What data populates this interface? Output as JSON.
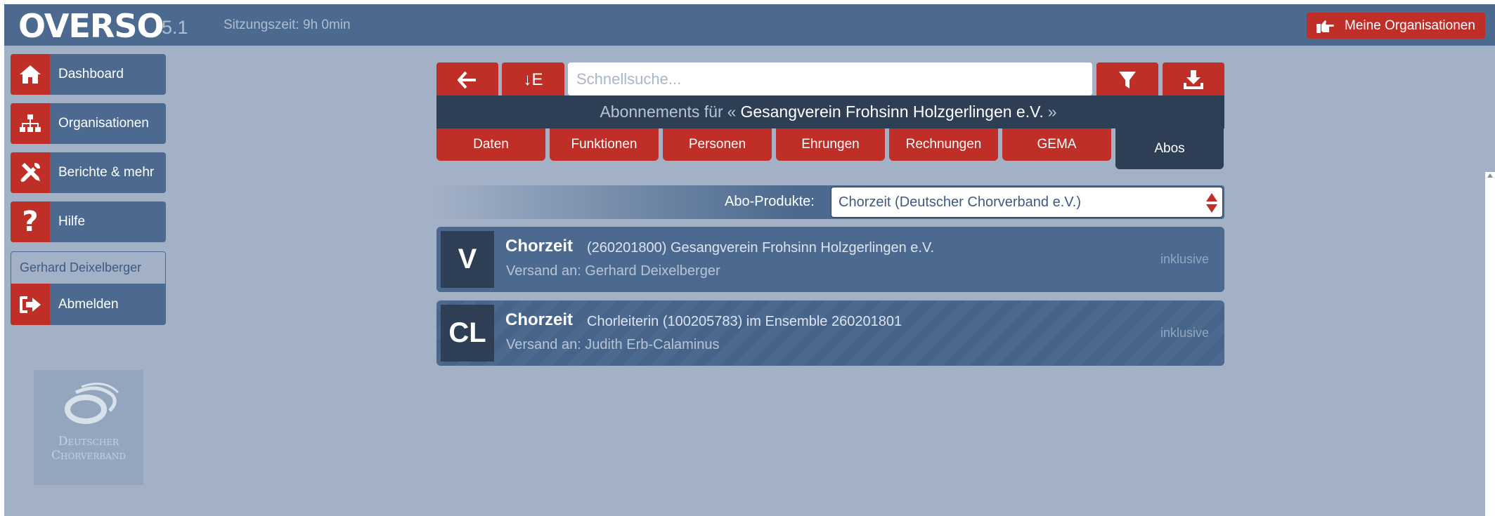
{
  "app": {
    "brand": "OVERSO",
    "version": "5.1",
    "session": "Sitzungszeit: 9h 0min",
    "my_orgs_label": "Meine Organisationen"
  },
  "sidebar": {
    "items": [
      {
        "label": "Dashboard",
        "icon": "home-icon"
      },
      {
        "label": "Organisationen",
        "icon": "sitemap-icon"
      },
      {
        "label": "Berichte & mehr",
        "icon": "tools-icon"
      },
      {
        "label": "Hilfe",
        "icon": "question-icon"
      }
    ],
    "user_name": "Gerhard Deixelberger",
    "logout_label": "Abmelden",
    "logo_line1": "Deutscher",
    "logo_line2": "Chorverband"
  },
  "toolbar": {
    "sort_label": "↓E",
    "search_placeholder": "Schnellsuche..."
  },
  "title": {
    "prefix": "Abonnements für",
    "open_quote": "«",
    "org_name": "Gesangverein Frohsinn Holzgerlingen e.V.",
    "close_quote": "»"
  },
  "tabs": [
    {
      "label": "Daten"
    },
    {
      "label": "Funktionen"
    },
    {
      "label": "Personen"
    },
    {
      "label": "Ehrungen"
    },
    {
      "label": "Rechnungen"
    },
    {
      "label": "GEMA"
    },
    {
      "label": "Abos",
      "active": true
    }
  ],
  "abo_products": {
    "label": "Abo-Produkte:",
    "selected": "Chorzeit (Deutscher Chorverband e.V.)"
  },
  "subscriptions": [
    {
      "badge": "V",
      "title": "Chorzeit",
      "detail": "(260201800) Gesangverein Frohsinn Holzgerlingen e.V.",
      "shipping": "Versand an: Gerhard Deixelberger",
      "status": "inklusive"
    },
    {
      "badge": "CL",
      "title": "Chorzeit",
      "detail": "Chorleiterin (100205783) im Ensemble 260201801",
      "shipping": "Versand an: Judith Erb-Calaminus",
      "status": "inklusive"
    }
  ],
  "colors": {
    "background": "#a2b1c6",
    "primary": "#4c6a8f",
    "dark": "#2d3e55",
    "accent_red": "#bf2f27"
  }
}
